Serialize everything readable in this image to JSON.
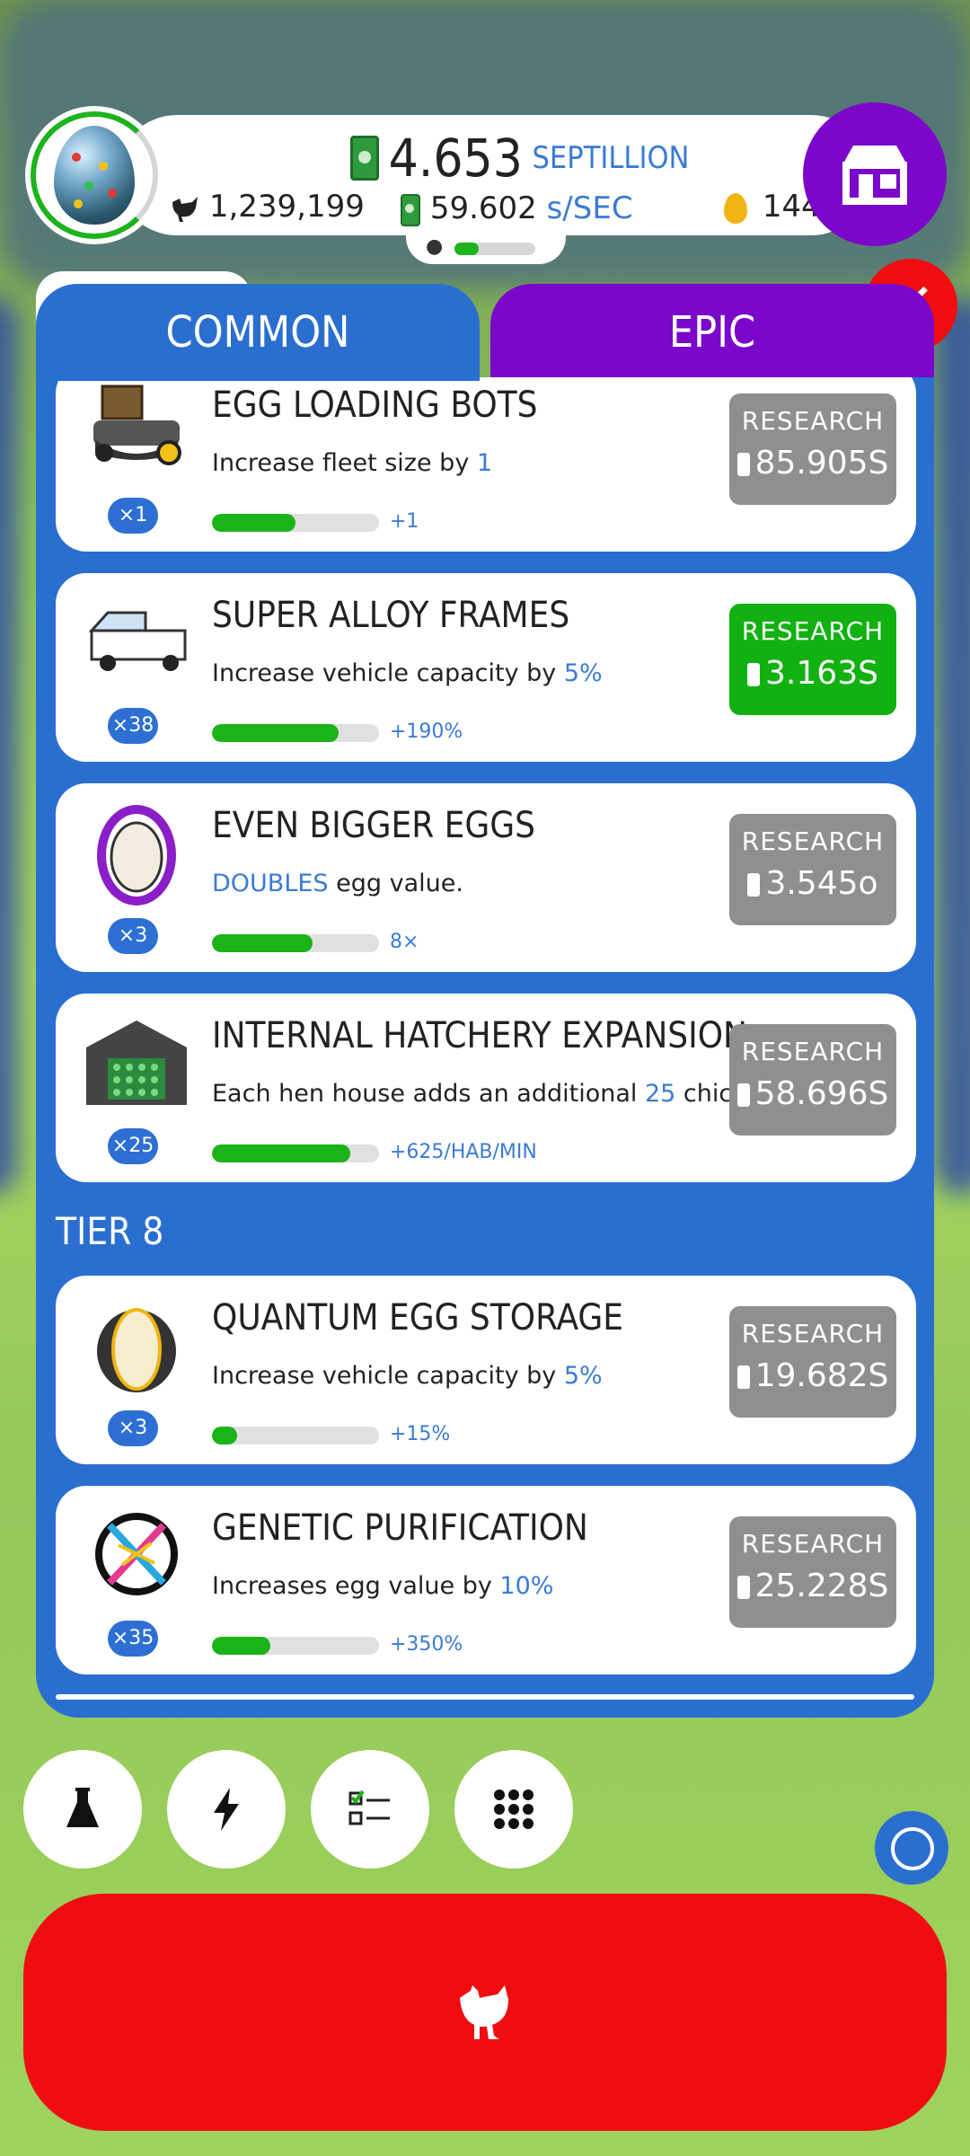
{
  "header": {
    "money_value": "4.653",
    "money_unit": "SEPTILLION",
    "rate_value": "59.602",
    "rate_unit": "s/SEC",
    "chicken_count": "1,239,199",
    "golden_eggs": "144",
    "hatch_progress": 0.3
  },
  "tabs": [
    {
      "label": "COMMON",
      "selected": true
    },
    {
      "label": "EPIC",
      "selected": false
    }
  ],
  "research_items": [
    {
      "title": "EGG LOADING BOTS",
      "desc_pre": "Increase fleet size by ",
      "desc_hl": "1",
      "desc_post": "",
      "level": "×1",
      "progress": 0.5,
      "effect": "+1",
      "button": "RESEARCH",
      "price": "85.905S",
      "affordable": false,
      "icon": "loading-bot-icon"
    },
    {
      "title": "SUPER ALLOY FRAMES",
      "desc_pre": "Increase vehicle capacity by ",
      "desc_hl": "5%",
      "desc_post": "",
      "level": "×38",
      "progress": 0.76,
      "effect": "+190%",
      "button": "RESEARCH",
      "price": "3.163S",
      "affordable": true,
      "icon": "truck-icon"
    },
    {
      "title": "EVEN BIGGER EGGS",
      "desc_pre": "",
      "desc_hl": "DOUBLES",
      "desc_post": " egg value.",
      "level": "×3",
      "progress": 0.6,
      "effect": "8×",
      "button": "RESEARCH",
      "price": "3.545o",
      "affordable": false,
      "icon": "big-egg-icon"
    },
    {
      "title": "INTERNAL HATCHERY EXPANSION",
      "desc_pre": "Each hen house adds an additional ",
      "desc_hl": "25",
      "desc_post": " chickens/min",
      "level": "×25",
      "progress": 0.83,
      "effect": "+625/HAB/MIN",
      "button": "RESEARCH",
      "price": "58.696S",
      "affordable": false,
      "icon": "hatchery-icon"
    }
  ],
  "tier8": {
    "label": "TIER 8",
    "items": [
      {
        "title": "QUANTUM EGG STORAGE",
        "desc_pre": "Increase vehicle capacity by ",
        "desc_hl": "5%",
        "desc_post": "",
        "level": "×3",
        "progress": 0.15,
        "effect": "+15%",
        "button": "RESEARCH",
        "price": "19.682S",
        "affordable": false,
        "icon": "quantum-egg-icon"
      },
      {
        "title": "GENETIC PURIFICATION",
        "desc_pre": "Increases egg value by ",
        "desc_hl": "10%",
        "desc_post": "",
        "level": "×35",
        "progress": 0.35,
        "effect": "+350%",
        "button": "RESEARCH",
        "price": "25.228S",
        "affordable": false,
        "icon": "dna-icon"
      }
    ]
  },
  "bottom_buttons": [
    "flask-icon",
    "lightning-icon",
    "checklist-icon",
    "grid-icon"
  ],
  "colors": {
    "accent_blue": "#2a6fd0",
    "epic_purple": "#7a07c9",
    "green": "#10b110",
    "red": "#ef0d12"
  }
}
